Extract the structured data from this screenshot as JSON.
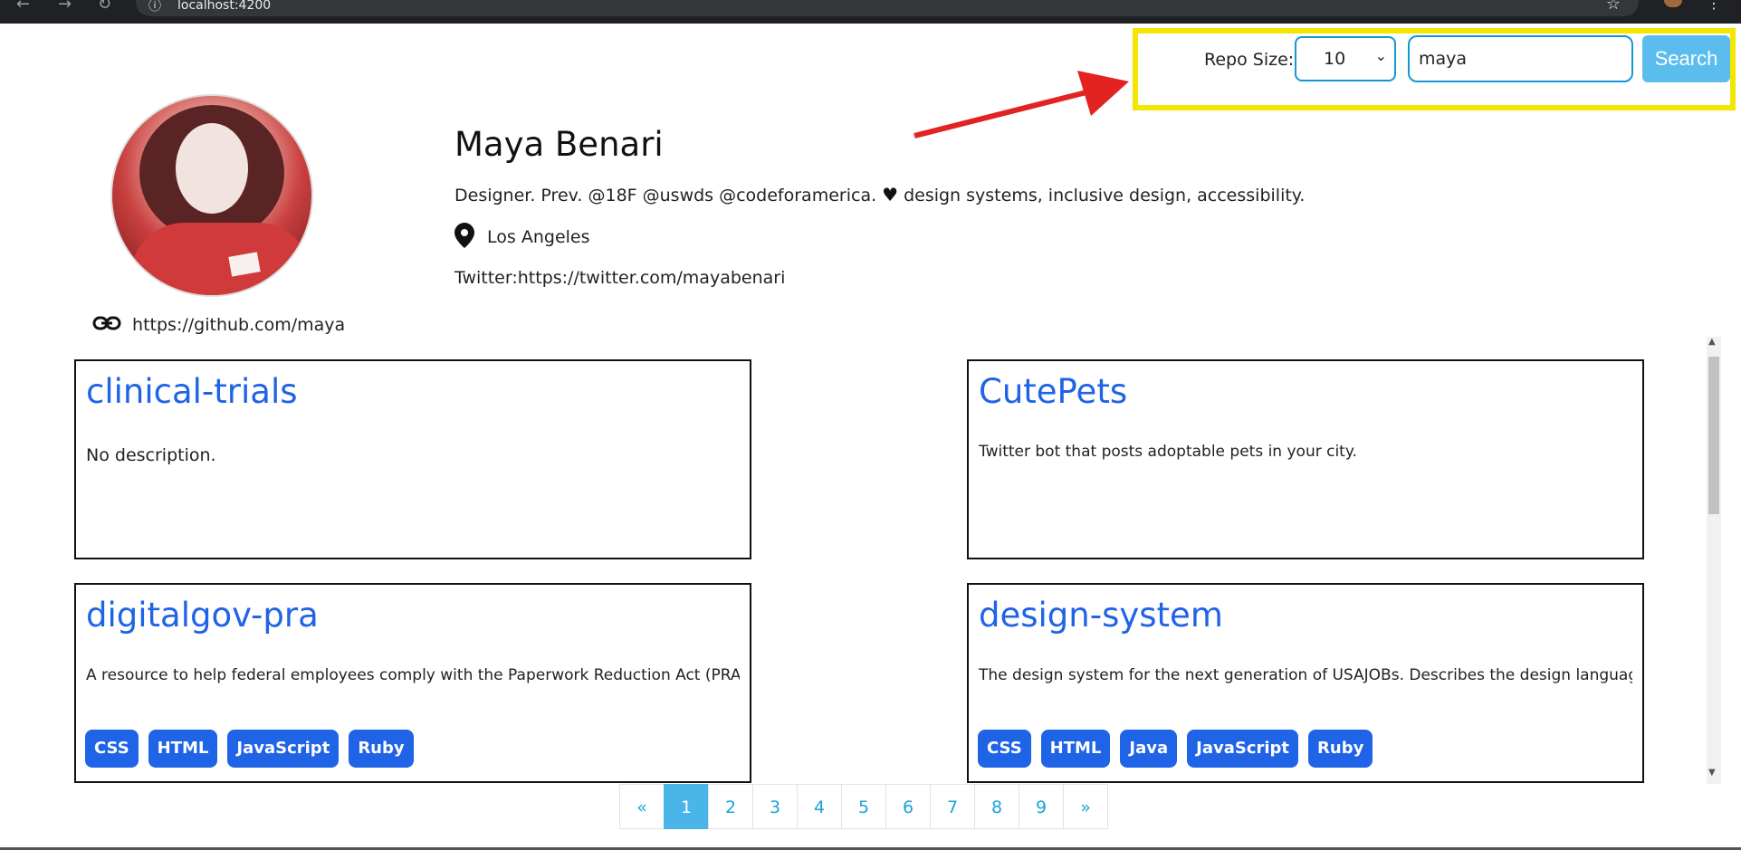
{
  "browser": {
    "url": "localhost:4200"
  },
  "search": {
    "repo_size_label": "Repo Size:",
    "repo_size_value": "10",
    "query": "maya",
    "button_label": "Search"
  },
  "profile": {
    "name": "Maya Benari",
    "bio_part1": "Designer. Prev. @18F @uswds @codeforamerica.",
    "bio_part2": "design systems, inclusive design, accessibility.",
    "location": "Los Angeles",
    "twitter": "Twitter:https://twitter.com/mayabenari",
    "github_url": "https://github.com/maya"
  },
  "repos": [
    {
      "name": "clinical-trials",
      "description": "No description.",
      "tags": []
    },
    {
      "name": "CutePets",
      "description": "Twitter bot that posts adoptable pets in your city.",
      "tags": []
    },
    {
      "name": "digitalgov-pra",
      "description": "A resource to help federal employees comply with the Paperwork Reduction Act (PRA)",
      "tags": [
        "CSS",
        "HTML",
        "JavaScript",
        "Ruby"
      ]
    },
    {
      "name": "design-system",
      "description": "The design system for the next generation of USAJOBs. Describes the design language and ...",
      "tags": [
        "CSS",
        "HTML",
        "Java",
        "JavaScript",
        "Ruby"
      ]
    }
  ],
  "pagination": {
    "prev": "«",
    "pages": [
      "1",
      "2",
      "3",
      "4",
      "5",
      "6",
      "7",
      "8",
      "9"
    ],
    "active": "1",
    "next": "»"
  },
  "colors": {
    "link_blue": "#1f63e6",
    "highlight_yellow": "#f3e600",
    "arrow_red": "#e32222",
    "search_button": "#5bbcee"
  }
}
